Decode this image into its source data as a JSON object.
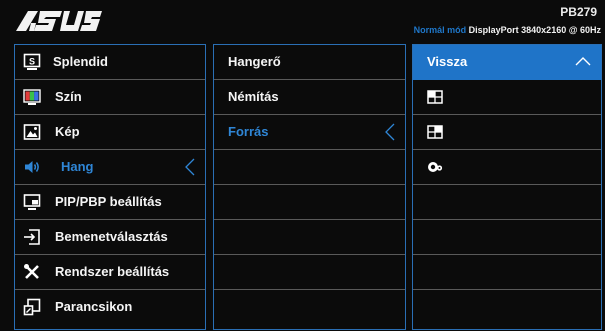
{
  "header": {
    "brand": "ASUS",
    "model": "PB279",
    "mode": "Normál mód",
    "input": "DisplayPort",
    "resolution": "3840x2160 @ 60Hz"
  },
  "main_menu": [
    {
      "label": "Splendid",
      "icon": "splendid-icon"
    },
    {
      "label": "Szín",
      "icon": "color-icon"
    },
    {
      "label": "Kép",
      "icon": "image-icon"
    },
    {
      "label": "Hang",
      "icon": "speaker-icon",
      "selected": true
    },
    {
      "label": "PIP/PBP beállítás",
      "icon": "pip-icon"
    },
    {
      "label": "Bemenetválasztás",
      "icon": "input-icon"
    },
    {
      "label": "Rendszer beállítás",
      "icon": "tools-icon"
    },
    {
      "label": "Parancsikon",
      "icon": "shortcut-icon"
    }
  ],
  "sub_menu": [
    {
      "label": "Hangerő"
    },
    {
      "label": "Némítás"
    },
    {
      "label": "Forrás",
      "selected": true
    }
  ],
  "options": {
    "back_label": "Vissza",
    "items": [
      "pbp-source-1-icon",
      "pbp-source-2-icon",
      "dp-audio-icon"
    ]
  },
  "colors": {
    "accent": "#1f74c8",
    "selected_text": "#2f86d6",
    "border": "#2a6fb5",
    "background": "#0b0b0b"
  }
}
